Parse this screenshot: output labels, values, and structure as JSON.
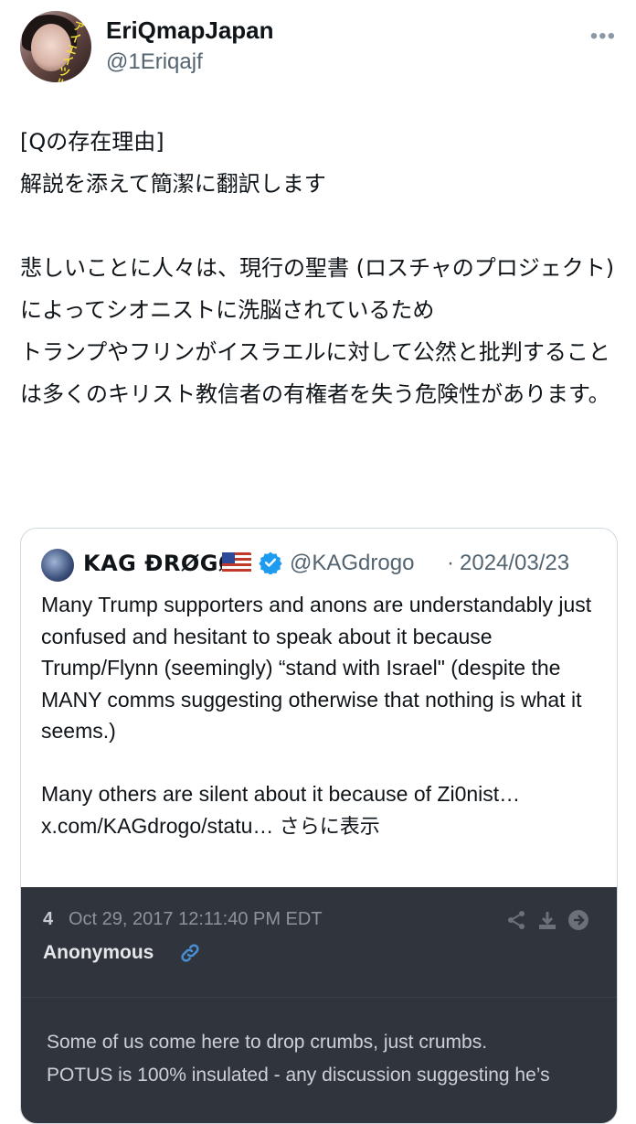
{
  "author": {
    "display_name": "EriQmapJapan",
    "handle": "@1Eriqajf",
    "avatar_sticker_text": "アイエイ ツル",
    "more_icon": "more-dots-icon"
  },
  "tweet": {
    "text": "[Qの存在理由]\n解説を添えて簡潔に翻訳します\n\n悲しいことに人々は、現行の聖書 (ロスチャのプロジェクト) によってシオニストに洗脳されているため\nトランプやフリンがイスラエルに対して公然と批判することは多くのキリスト教信者の有権者を失う危険性があります。"
  },
  "quote": {
    "name": "KAG ĐRØGØ",
    "flag": "🇺🇸",
    "verified_icon": "verified-badge-icon",
    "handle": "@KAGdrogo",
    "separator": "·",
    "date": "2024/03/23",
    "body": "Many Trump supporters and anons are understandably just confused and hesitant to speak about it because Trump/Flynn (seemingly) “stand with Israel\" (despite the MANY comms suggesting otherwise that nothing is what it seems.)\n\nMany others are silent about it because of Zi0nist… x.com/KAGdrogo/statu… ",
    "show_more": "さらに表示"
  },
  "media": {
    "post_number": "4",
    "post_date": "Oct 29, 2017 12:11:40 PM EDT",
    "poster": "Anonymous",
    "icons": [
      "share-icon",
      "download-icon",
      "arrow-right-icon",
      "link-icon"
    ],
    "body": "Some of us come here to drop crumbs, just crumbs.\nPOTUS is 100% insulated - any discussion suggesting he’s"
  },
  "colors": {
    "text_primary": "#0f1419",
    "text_secondary": "#536471",
    "border": "#cfd9de",
    "verified_blue": "#1d9bf0",
    "media_bg": "#30353d"
  }
}
